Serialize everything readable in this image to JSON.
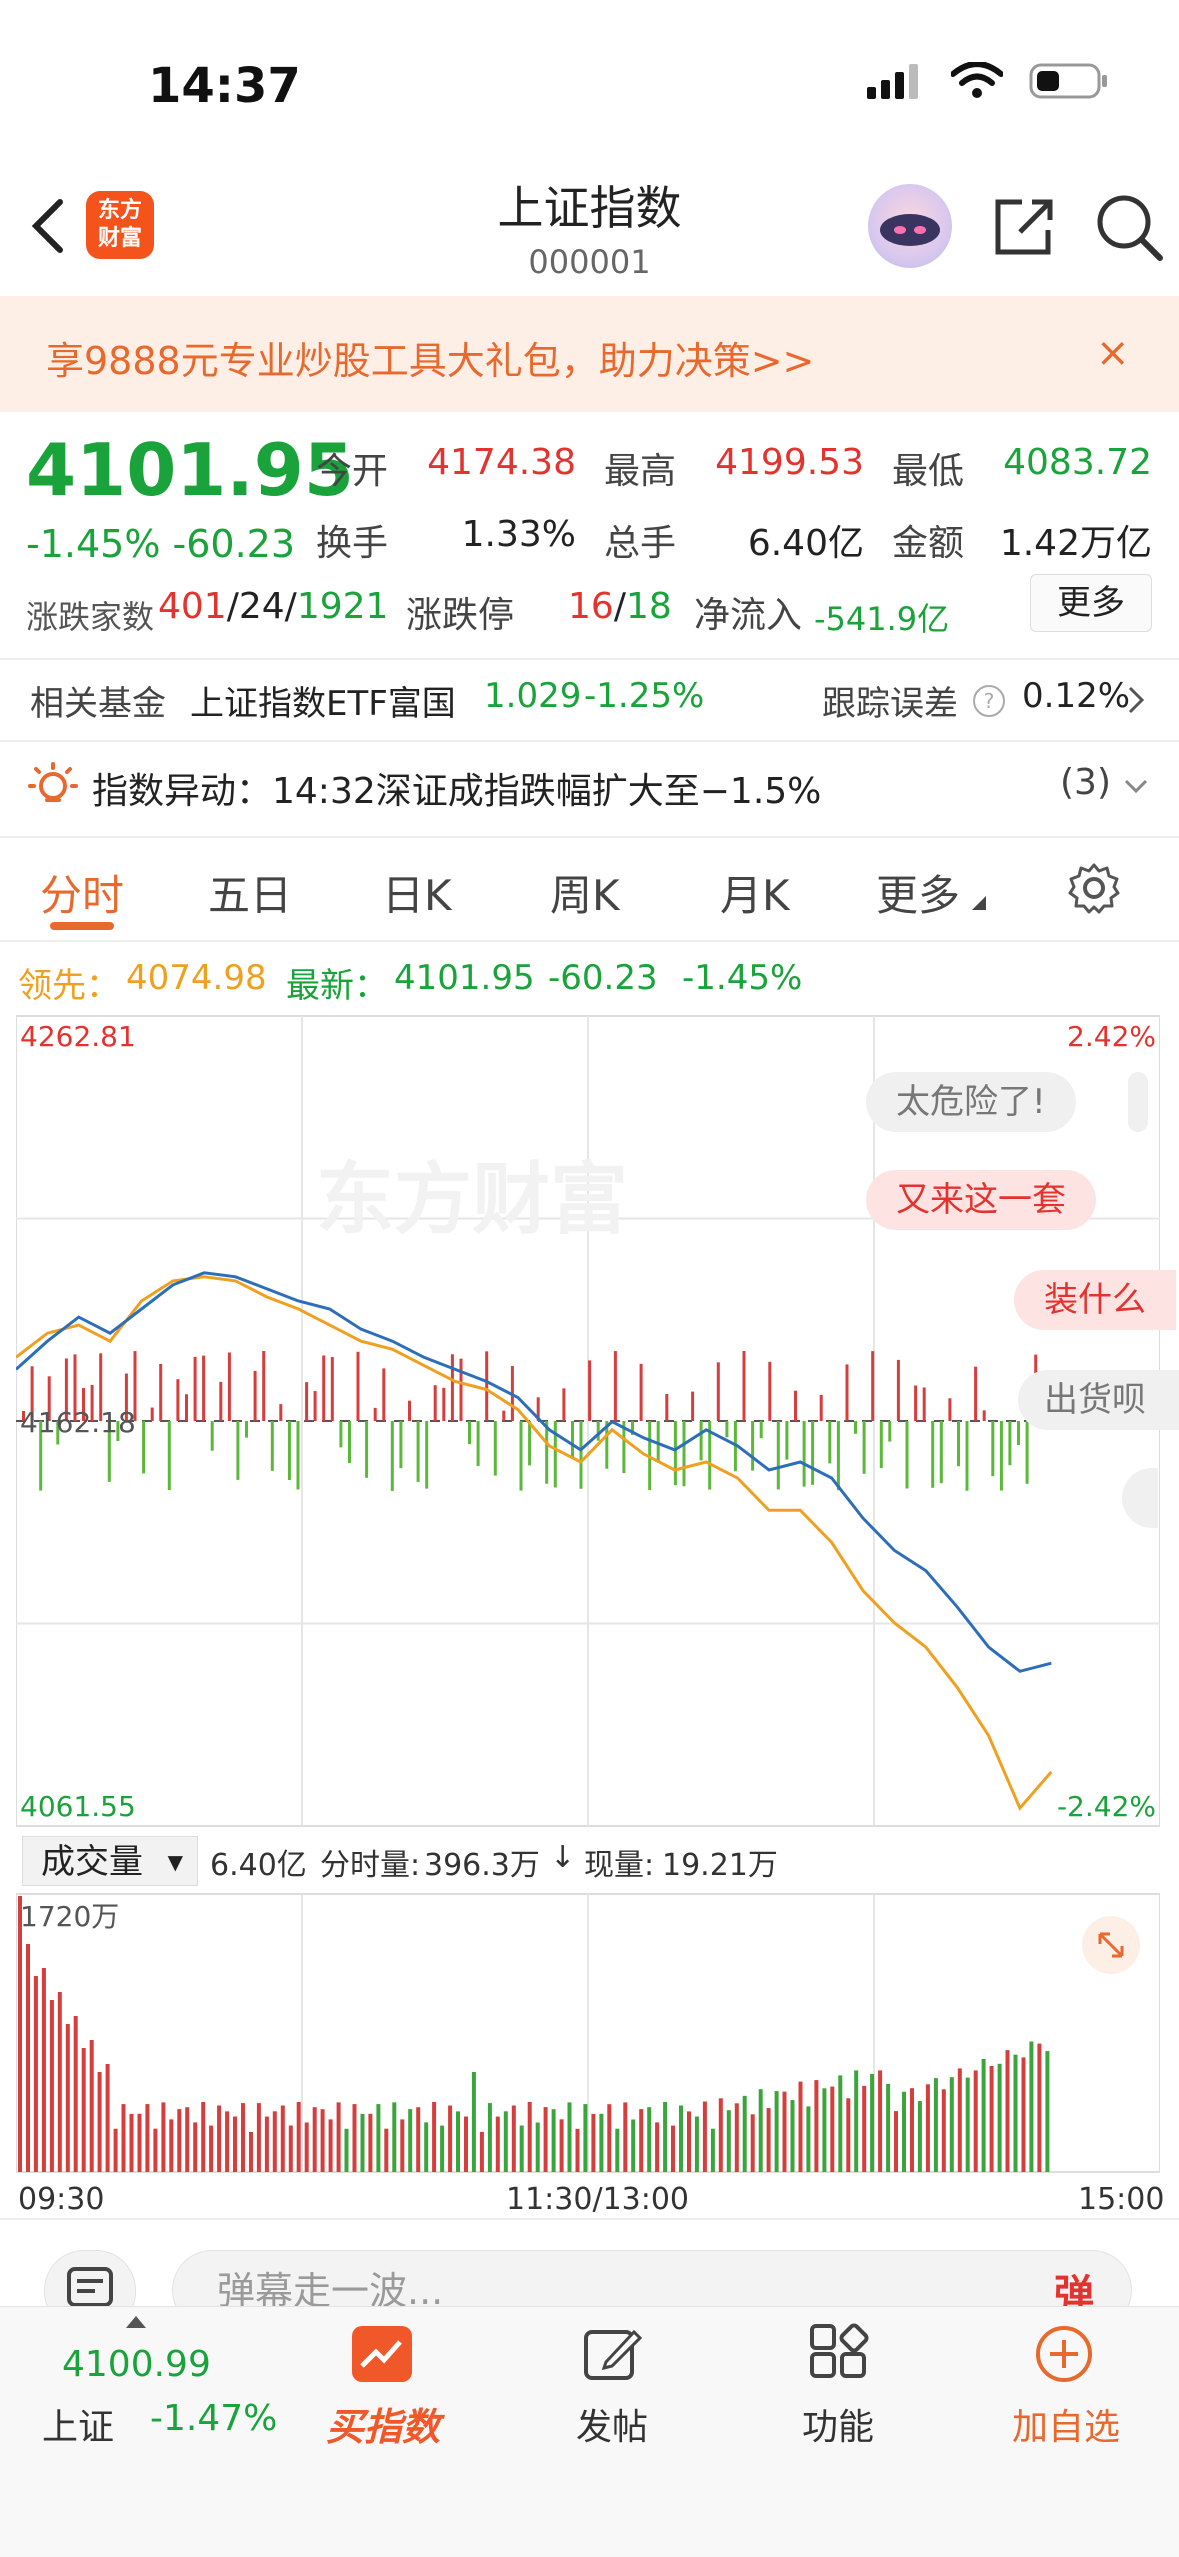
{
  "status": {
    "time": "14:37"
  },
  "header": {
    "logo_text": "东方\n财富",
    "title": "上证指数",
    "code": "000001"
  },
  "banner": {
    "text": "享9888元专业炒股工具大礼包，助力决策>>",
    "close": "×"
  },
  "quote": {
    "price": "4101.95",
    "change": "-1.45% -60.23",
    "open_label": "今开",
    "open": "4174.38",
    "high_label": "最高",
    "high": "4199.53",
    "low_label": "最低",
    "low": "4083.72",
    "turnover_label": "换手",
    "turnover": "1.33%",
    "volume_label": "总手",
    "volume": "6.40亿",
    "amount_label": "金额",
    "amount": "1.42万亿",
    "breadth_label": "涨跌家数",
    "up": "401",
    "flat": "24",
    "down": "1921",
    "limit_label": "涨跌停",
    "limit_up": "16",
    "limit_down": "18",
    "inflow_label": "净流入",
    "inflow": "-541.9亿",
    "more": "更多"
  },
  "fund": {
    "label": "相关基金",
    "name": "上证指数ETF富国",
    "price": "1.029",
    "change": "-1.25%",
    "track_label": "跟踪误差",
    "track_value": "0.12%"
  },
  "alert": {
    "text": "指数异动：14:32深证成指跌幅扩大至−1.5%",
    "count": "(3)"
  },
  "tabs": [
    "分时",
    "五日",
    "日K",
    "周K",
    "月K",
    "更多"
  ],
  "legend": {
    "lead_label": "领先：",
    "lead_value": "4074.98",
    "latest_label": "最新：",
    "latest_value": "4101.95",
    "latest_change": "-60.23",
    "latest_pct": "-1.45%"
  },
  "chart_data": {
    "type": "line",
    "title": "",
    "ylim": [
      4061.55,
      4262.81
    ],
    "y_ticks": [
      "4262.81",
      "4162.18",
      "4061.55"
    ],
    "pct_ticks": [
      "2.42%",
      "-2.42%"
    ],
    "x_ticks": [
      "09:30",
      "11:30/13:00",
      "15:00"
    ],
    "series": [
      {
        "name": "最新",
        "color": "#2c6fb8",
        "values": [
          4175,
          4182,
          4188,
          4184,
          4190,
          4196,
          4199,
          4198,
          4195,
          4192,
          4190,
          4185,
          4182,
          4178,
          4175,
          4172,
          4168,
          4160,
          4155,
          4162,
          4158,
          4155,
          4160,
          4156,
          4150,
          4152,
          4148,
          4138,
          4130,
          4125,
          4116,
          4106,
          4100,
          4102
        ]
      },
      {
        "name": "领先",
        "color": "#f0a020",
        "values": [
          4178,
          4184,
          4186,
          4182,
          4192,
          4197,
          4198,
          4197,
          4193,
          4190,
          4186,
          4182,
          4180,
          4176,
          4172,
          4170,
          4165,
          4156,
          4152,
          4160,
          4154,
          4150,
          4152,
          4148,
          4140,
          4140,
          4132,
          4120,
          4112,
          4106,
          4096,
          4084,
          4066,
          4075
        ]
      }
    ]
  },
  "danmu": [
    "太危险了!",
    "又来这一套",
    "装什么",
    "出货呗"
  ],
  "watermark": "东方财富",
  "volume": {
    "selector": "成交量",
    "total": "6.40亿",
    "period_label": "分时量:",
    "period_value": "396.3万",
    "current_label": "现量:",
    "current_value": "19.21万",
    "max": "1720万"
  },
  "comment": {
    "placeholder": "弹幕走一波...",
    "danmu_btn": "弹"
  },
  "bottom": {
    "index_value": "4100.99",
    "index_name": "上证",
    "index_pct": "-1.47%",
    "buy": "买指数",
    "post": "发帖",
    "func": "功能",
    "add": "加自选"
  }
}
